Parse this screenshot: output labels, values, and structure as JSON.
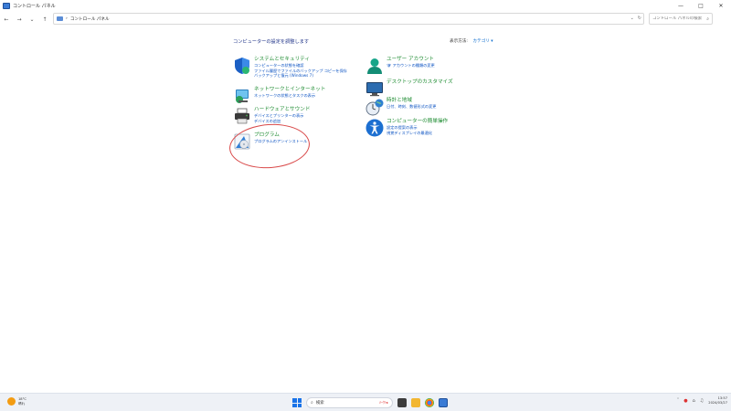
{
  "window": {
    "title": "コントロール パネル",
    "controls": [
      "—",
      "□",
      "✕"
    ]
  },
  "nav": {
    "back": "←",
    "forward": "→",
    "down": "⌄",
    "up": "↑",
    "breadcrumb_sep": "›",
    "breadcrumb": "コントロール パネル",
    "dropdown": "⌄",
    "refresh": "↻"
  },
  "search": {
    "placeholder": "コントロール パネルの検索",
    "icon": "⌕"
  },
  "content": {
    "heading": "コンピューターの設定を調整します",
    "viewby_label": "表示方法:",
    "viewby_value": "カテゴリ ▾"
  },
  "categories_left": [
    {
      "title": "システムとセキュリティ",
      "links": [
        "コンピューターの状態を確認",
        "ファイル履歴でファイルのバックアップ コピーを保存",
        "バックアップと復元 (Windows 7)"
      ],
      "icon": "shield-icon"
    },
    {
      "title": "ネットワークとインターネット",
      "links": [
        "ネットワークの状態とタスクの表示"
      ],
      "icon": "network-icon"
    },
    {
      "title": "ハードウェアとサウンド",
      "links": [
        "デバイスとプリンターの表示",
        "デバイスの追加"
      ],
      "icon": "printer-icon"
    },
    {
      "title": "プログラム",
      "links": [
        "プログラムのアンインストール"
      ],
      "icon": "programs-icon"
    }
  ],
  "categories_right": [
    {
      "title": "ユーザー アカウント",
      "links": [
        "アカウントの種類の変更"
      ],
      "icon": "user-icon"
    },
    {
      "title": "デスクトップのカスタマイズ",
      "links": [],
      "icon": "desktop-icon"
    },
    {
      "title": "時計と地域",
      "links": [
        "日付、時刻、数値形式の変更"
      ],
      "icon": "clock-icon"
    },
    {
      "title": "コンピューターの簡単操作",
      "links": [
        "設定の提案の表示",
        "視覚ディスプレイの最適化"
      ],
      "icon": "accessibility-icon"
    }
  ],
  "taskbar": {
    "weather_temp": "18°C",
    "weather_cond": "晴れ",
    "search_icon": "⌕",
    "search_placeholder": "検索",
    "search_deco": "ﾒｰｹﾄ▸",
    "tray_up": "ˆ",
    "tray_icons": [
      "●",
      "⌂",
      "♫"
    ],
    "time": "13:57",
    "date": "2024/03/27",
    "colors": {
      "start": "#1a73e8",
      "accent": "#0a52c2",
      "category_title": "#1a8a2e",
      "annotation": "#d94a4a"
    }
  }
}
